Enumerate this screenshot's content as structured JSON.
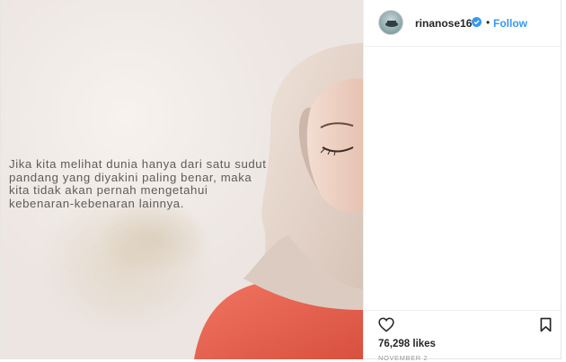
{
  "post": {
    "image_quote": "Jika kita melihat dunia hanya dari satu sudut pandang yang diyakini paling benar, maka kita tidak akan pernah mengetahui kebenaran-kebenaran lainnya.",
    "username": "rinanose16",
    "follow_separator": "•",
    "follow_label": "Follow",
    "likes": "76,298 likes",
    "date": "NOVEMBER 2"
  },
  "icons": {
    "avatar": "avatar-image",
    "verified": "verified-badge-icon",
    "like": "heart-outline-icon",
    "save": "bookmark-outline-icon"
  },
  "colors": {
    "follow": "#3897f0",
    "verified": "#3897f0",
    "text": "#262626",
    "muted": "#999999",
    "scarf": "#e8d9cf",
    "shirt": "#e7604e"
  }
}
